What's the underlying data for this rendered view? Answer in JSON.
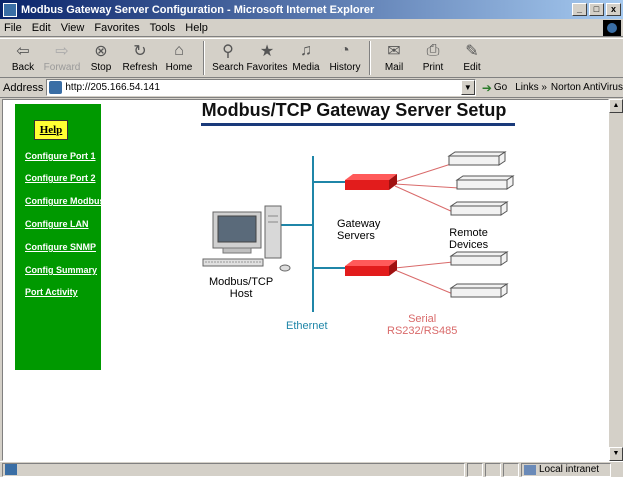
{
  "window": {
    "title": "Modbus Gateway Server Configuration - Microsoft Internet Explorer",
    "buttons": [
      "_",
      "□",
      "x"
    ]
  },
  "menu": [
    "File",
    "Edit",
    "View",
    "Favorites",
    "Tools",
    "Help"
  ],
  "toolbar": [
    {
      "label": "Back",
      "icon": "back-arrow-icon",
      "glyph": "⇦",
      "enabled": true
    },
    {
      "label": "Forward",
      "icon": "forward-arrow-icon",
      "glyph": "⇨",
      "enabled": false
    },
    {
      "label": "Stop",
      "icon": "stop-icon",
      "glyph": "⊗",
      "enabled": true
    },
    {
      "label": "Refresh",
      "icon": "refresh-icon",
      "glyph": "↻",
      "enabled": true
    },
    {
      "label": "Home",
      "icon": "home-icon",
      "glyph": "⌂",
      "enabled": true
    },
    {
      "label": "Search",
      "icon": "search-icon",
      "glyph": "⚲",
      "enabled": true
    },
    {
      "label": "Favorites",
      "icon": "favorites-icon",
      "glyph": "★",
      "enabled": true
    },
    {
      "label": "Media",
      "icon": "media-icon",
      "glyph": "♫",
      "enabled": true
    },
    {
      "label": "History",
      "icon": "history-icon",
      "glyph": "◔",
      "enabled": true
    },
    {
      "label": "Mail",
      "icon": "mail-icon",
      "glyph": "✉",
      "enabled": true
    },
    {
      "label": "Print",
      "icon": "print-icon",
      "glyph": "⎙",
      "enabled": true
    },
    {
      "label": "Edit",
      "icon": "edit-icon",
      "glyph": "✎",
      "enabled": true
    }
  ],
  "address": {
    "label": "Address",
    "url": "http://205.166.54.141",
    "go": "Go",
    "links": "Links",
    "link_items": [
      "Norton AntiVirus"
    ]
  },
  "sidebar": {
    "help": "Help",
    "links": [
      "Configure Port 1",
      "Configure Port 2",
      "Configure Modbus",
      "Configure LAN",
      "Configure SNMP",
      "Config Summary",
      "Port Activity"
    ]
  },
  "page": {
    "heading": "Modbus/TCP Gateway Server Setup",
    "diagram": {
      "host": "Modbus/TCP\nHost",
      "gateway": "Gateway\nServers",
      "remote": "Remote\nDevices",
      "ethernet": "Ethernet",
      "serial": "Serial\nRS232/RS485"
    }
  },
  "colors": {
    "sidebar_bg": "#009900",
    "help_bg": "#ffff33",
    "ethernet": "#1f86a8",
    "serial": "#d96a6a",
    "gateway": "#e21c1c"
  },
  "status": {
    "zone": "Local intranet"
  }
}
